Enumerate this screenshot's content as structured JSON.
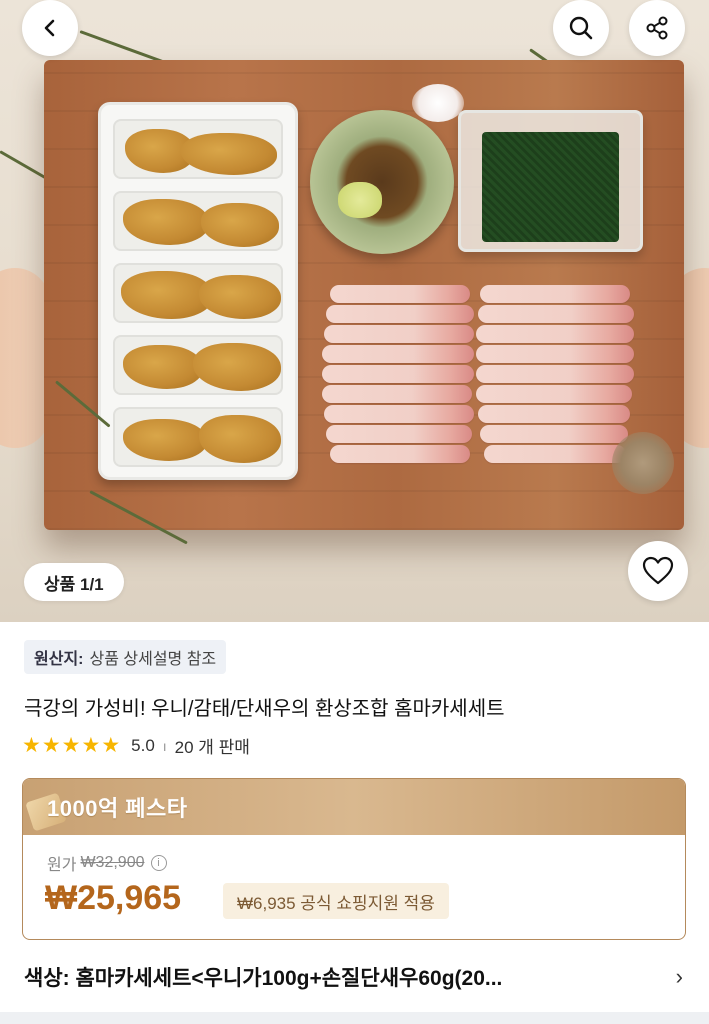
{
  "top_bar": {
    "back_icon": "chevron-left-icon",
    "search_icon": "search-icon",
    "share_icon": "share-icon"
  },
  "gallery": {
    "counter": "상품 1/1",
    "wishlist_icon": "heart-icon"
  },
  "product": {
    "origin_key": "원산지:",
    "origin_value": "상품 상세설명 참조",
    "title": "극강의 가성비! 우니/감태/단새우의 환상조합 홈마카세세트",
    "rating_value": "5.0",
    "rating_sep": "ı",
    "sales": "20 개 판매",
    "stars": 5
  },
  "deal": {
    "banner": "1000억 페스타",
    "original_label": "원가",
    "original_price": "₩32,900",
    "price": "₩25,965",
    "discount_note": "₩6,935 공식 쇼핑지원 적용"
  },
  "option": {
    "text": "색상: 홈마카세세트<우니가100g+손질단새우60g(20...",
    "chevron": "›"
  },
  "colors": {
    "price": "#b4661c",
    "star": "#f7b500",
    "deal_border": "#b48a5c"
  }
}
